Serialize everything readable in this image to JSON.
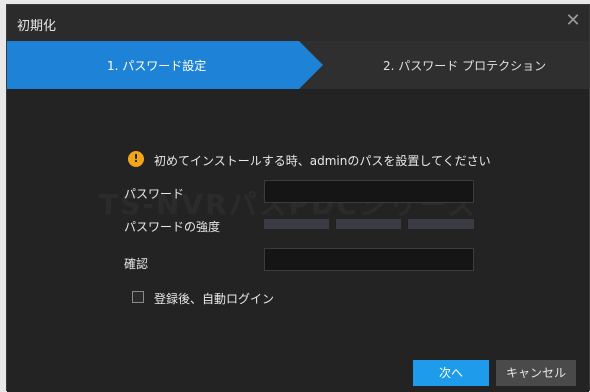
{
  "window": {
    "title": "初期化",
    "close_icon": "close-icon"
  },
  "steps": [
    {
      "label": "1. パスワード設定",
      "active": true
    },
    {
      "label": "2. パスワード  プロテクション",
      "active": false
    }
  ],
  "info": {
    "icon": "warning-icon",
    "text": "初めてインストールする時、adminのパスを設置してください",
    "color": "#f1a51b"
  },
  "watermark": "TS-NVRパスPDCシリーズ",
  "form": {
    "password_label": "パスワード",
    "password_value": "",
    "strength_label": "パスワードの強度",
    "strength_level": 0,
    "confirm_label": "確認",
    "confirm_value": "",
    "auto_login_label": "登録後、自動ログイン",
    "auto_login_checked": false
  },
  "buttons": {
    "next": "次へ",
    "cancel": "キャンセル"
  },
  "colors": {
    "accent": "#1e83d6",
    "button_primary": "#1e9bea",
    "background": "#232323"
  }
}
